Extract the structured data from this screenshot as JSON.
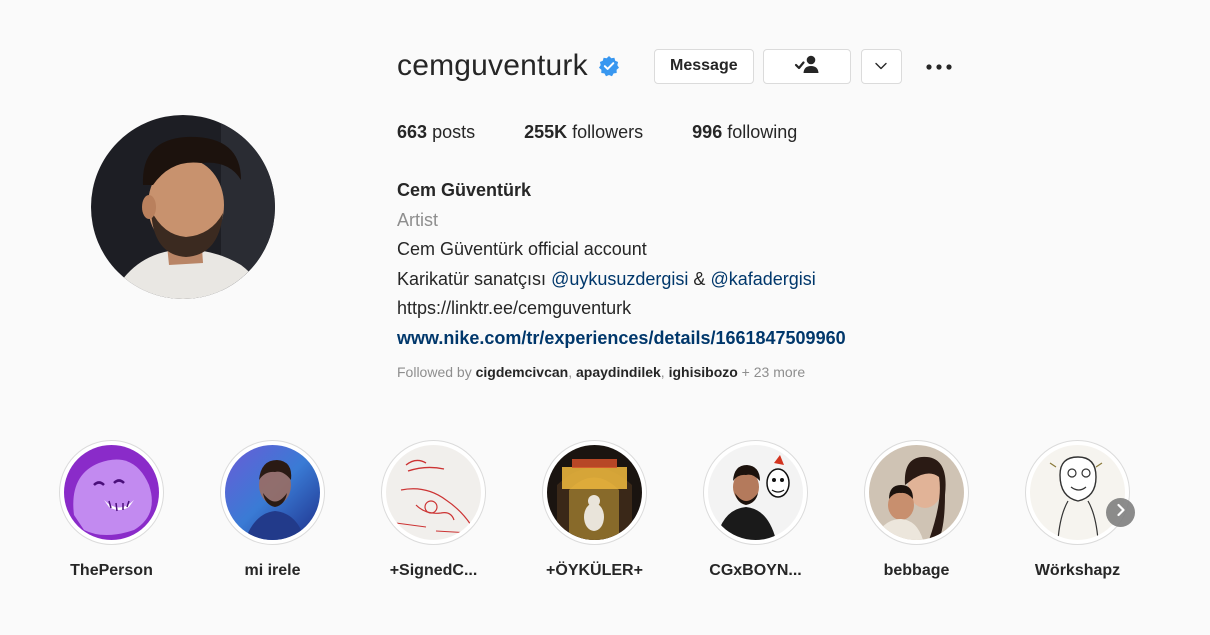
{
  "profile": {
    "username": "cemguventurk",
    "verified_icon": "verified-badge-icon",
    "message_label": "Message",
    "follow_icon": "following-check-icon",
    "chevron_icon": "chevron-down-icon",
    "more_icon": "more-options-icon"
  },
  "stats": {
    "posts_count": "663",
    "posts_label": "posts",
    "followers_count": "255K",
    "followers_label": "followers",
    "following_count": "996",
    "following_label": "following"
  },
  "bio": {
    "full_name": "Cem Güventürk",
    "category": "Artist",
    "line1": "Cem Güventürk official account",
    "line2_prefix": "Karikatür sanatçısı ",
    "mention1": "@uykusuzdergisi",
    "line2_join": " & ",
    "mention2": "@kafadergisi",
    "line3": "https://linktr.ee/cemguventurk",
    "website": "www.nike.com/tr/experiences/details/1661847509960"
  },
  "followed_by": {
    "prefix": "Followed by ",
    "user1": "cigdemcivcan",
    "user2": "apaydindilek",
    "user3": "ighisibozo",
    "suffix": " + 23 more"
  },
  "highlights": [
    {
      "label": "ThePerson"
    },
    {
      "label": "mi irele"
    },
    {
      "label": "+SignedC..."
    },
    {
      "label": "+ÖYKÜLER+"
    },
    {
      "label": "CGxBOYN..."
    },
    {
      "label": "bebbage"
    },
    {
      "label": "Wörkshapz"
    }
  ],
  "colors": {
    "accent_link": "#00376b",
    "verified_blue": "#3897f0",
    "muted_text": "#8e8e8e"
  }
}
